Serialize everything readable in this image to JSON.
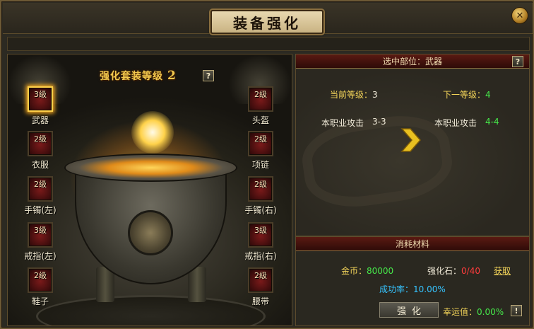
{
  "window": {
    "title": "装备强化",
    "close_icon": "close-icon"
  },
  "suit": {
    "title": "强化套装等级",
    "level": "2",
    "help": "?"
  },
  "slots": [
    {
      "id": "weapon",
      "label": "武器",
      "level": "3级",
      "selected": true
    },
    {
      "id": "helmet",
      "label": "头盔",
      "level": "2级",
      "selected": false
    },
    {
      "id": "armor",
      "label": "衣服",
      "level": "2级",
      "selected": false
    },
    {
      "id": "necklace",
      "label": "项链",
      "level": "2级",
      "selected": false
    },
    {
      "id": "bracelet-left",
      "label": "手镯(左)",
      "level": "2级",
      "selected": false
    },
    {
      "id": "bracelet-right",
      "label": "手镯(右)",
      "level": "2级",
      "selected": false
    },
    {
      "id": "ring-left",
      "label": "戒指(左)",
      "level": "3级",
      "selected": false
    },
    {
      "id": "ring-right",
      "label": "戒指(右)",
      "level": "3级",
      "selected": false
    },
    {
      "id": "shoes",
      "label": "鞋子",
      "level": "2级",
      "selected": false
    },
    {
      "id": "belt",
      "label": "腰带",
      "level": "2级",
      "selected": false
    }
  ],
  "selected_part": {
    "header": "选中部位：武器",
    "help": "?",
    "current_level_label": "当前等级：",
    "current_level_value": "3",
    "next_level_label": "下一等级：",
    "next_level_value": "4",
    "attack_label_current": "本职业攻击",
    "attack_value_current": "3-3",
    "attack_label_next": "本职业攻击",
    "attack_value_next": "4-4"
  },
  "materials": {
    "header": "消耗材料",
    "gold_label": "金币：",
    "gold_value": "80000",
    "stone_label": "强化石：",
    "stone_value": "0/40",
    "get_link": "获取",
    "success_rate": "成功率：10.00%",
    "enhance_button": "强化",
    "luck_label": "幸运值：",
    "luck_value": "0.00%",
    "luck_button": "!"
  },
  "colors": {
    "accent_gold": "#f5d65a",
    "value_green": "#46e84a",
    "warning_red": "#ff3c3c",
    "rate_cyan": "#36c4ff"
  }
}
